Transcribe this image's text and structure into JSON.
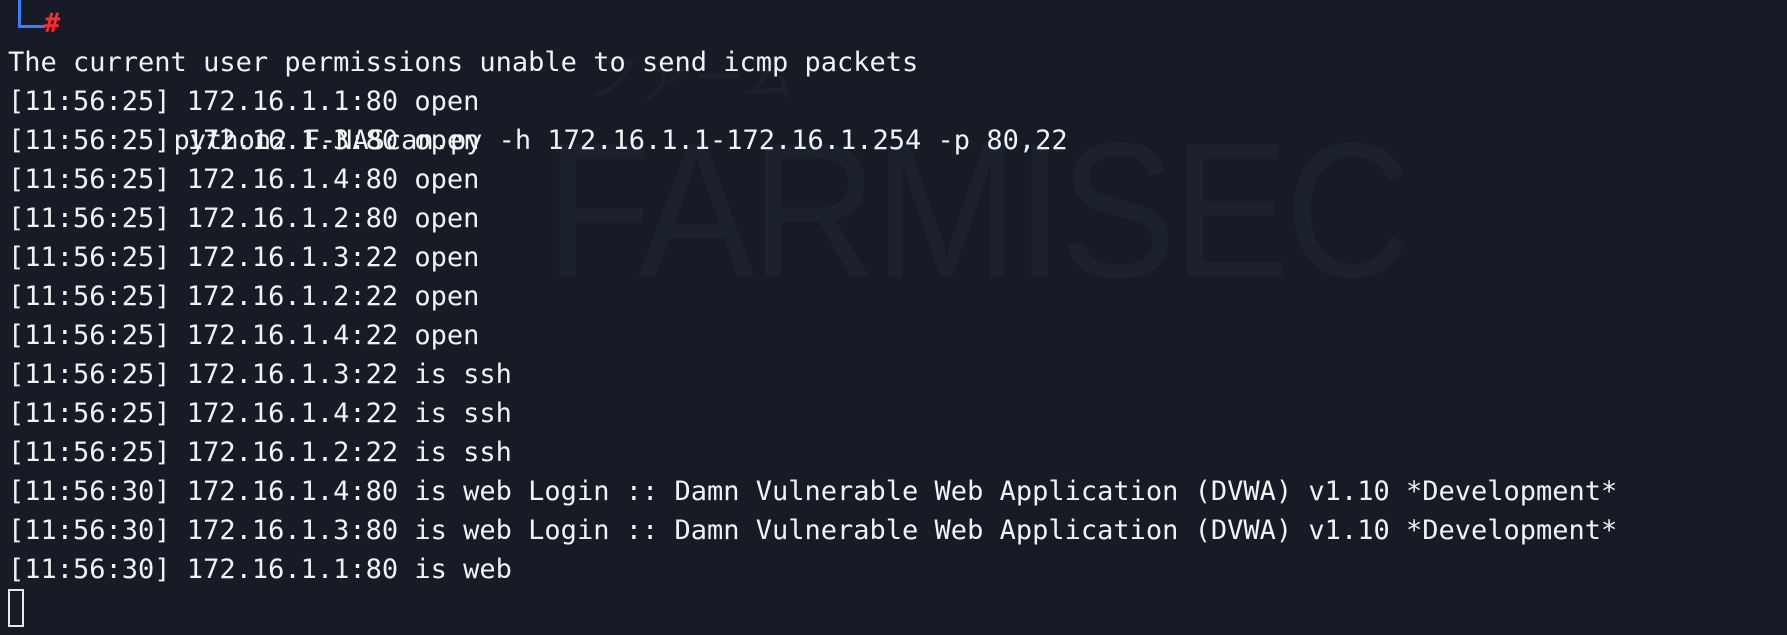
{
  "watermark": {
    "sub": "ファーム",
    "main": "FARMISEC"
  },
  "prompt": {
    "symbol": "#",
    "command": "python2 F-NAScan.py -h 172.16.1.1-172.16.1.254 -p 80,22"
  },
  "output": [
    "The current user permissions unable to send icmp packets",
    "[11:56:25] 172.16.1.1:80 open",
    "[11:56:25] 172.16.1.3:80 open",
    "[11:56:25] 172.16.1.4:80 open",
    "[11:56:25] 172.16.1.2:80 open",
    "[11:56:25] 172.16.1.3:22 open",
    "[11:56:25] 172.16.1.2:22 open",
    "[11:56:25] 172.16.1.4:22 open",
    "[11:56:25] 172.16.1.3:22 is ssh",
    "[11:56:25] 172.16.1.4:22 is ssh",
    "[11:56:25] 172.16.1.2:22 is ssh",
    "[11:56:30] 172.16.1.4:80 is web Login :: Damn Vulnerable Web Application (DVWA) v1.10 *Development*",
    "[11:56:30] 172.16.1.3:80 is web Login :: Damn Vulnerable Web Application (DVWA) v1.10 *Development*",
    "[11:56:30] 172.16.1.1:80 is web"
  ]
}
